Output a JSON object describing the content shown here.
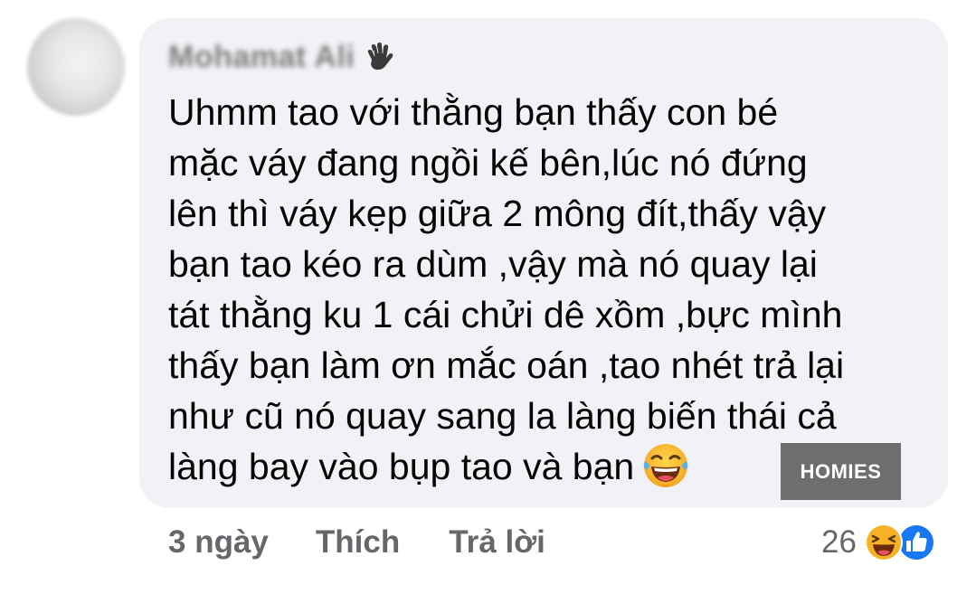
{
  "comment": {
    "author": "Mohamat Ali",
    "author_badge_icon": "wave-hand-icon",
    "lines": [
      "Uhmm tao với thằng bạn thấy con bé",
      "mặc váy đang ngồi kế bên,lúc nó đứng",
      "lên thì váy kẹp giữa 2 mông đít,thấy vậy",
      "bạn tao kéo ra dùm ,vậy mà nó quay lại",
      "tát thằng ku  1 cái chửi dê xồm ,bực mình",
      "thấy bạn làm ơn mắc oán ,tao nhét trả lại",
      "như cũ nó quay sang la làng biến thái cả",
      "làng bay vào bụp tao và bạn"
    ],
    "inline_emoji": "tears-of-joy-emoji"
  },
  "watermark": "HOMIES",
  "actions": {
    "time": "3 ngày",
    "like_label": "Thích",
    "reply_label": "Trả lời"
  },
  "reactions": {
    "count": "26",
    "icons": [
      "haha-reaction-icon",
      "like-reaction-icon"
    ]
  },
  "colors": {
    "bubble_bg": "#f0f2f5",
    "text": "#050505",
    "secondary_text": "#65676b",
    "like_blue": "#1877f2",
    "emoji_yellow": "#f7b125"
  }
}
